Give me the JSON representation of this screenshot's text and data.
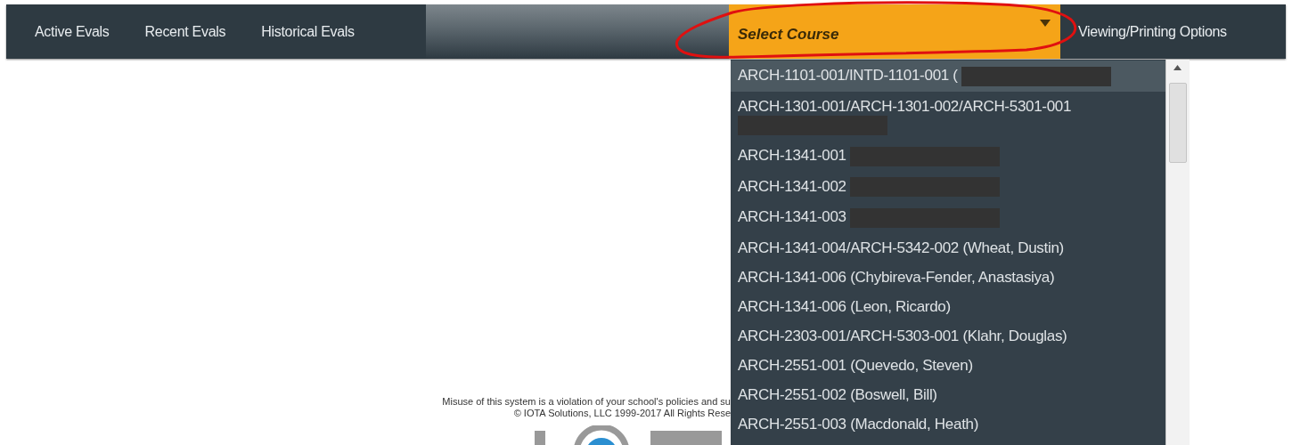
{
  "nav_tabs": [
    {
      "label": "Active Evals"
    },
    {
      "label": "Recent Evals"
    },
    {
      "label": "Historical Evals"
    }
  ],
  "course_select": {
    "placeholder": "Select Course",
    "expanded": true
  },
  "options_link": {
    "label": "Viewing/Printing Options"
  },
  "annotation_circle": true,
  "course_options": [
    {
      "label": "ARCH-1101-001/INTD-1101-001 (",
      "redacted": true,
      "selected": true
    },
    {
      "label": "ARCH-1301-001/ARCH-1301-002/ARCH-5301-001",
      "redacted": true,
      "selected": false
    },
    {
      "label": "ARCH-1341-001",
      "redacted": true,
      "selected": false
    },
    {
      "label": "ARCH-1341-002",
      "redacted": true,
      "selected": false
    },
    {
      "label": "ARCH-1341-003",
      "redacted": true,
      "selected": false
    },
    {
      "label": "ARCH-1341-004/ARCH-5342-002 (Wheat, Dustin)",
      "redacted": false,
      "selected": false
    },
    {
      "label": "ARCH-1341-006 (Chybireva-Fender, Anastasiya)",
      "redacted": false,
      "selected": false
    },
    {
      "label": "ARCH-1341-006 (Leon, Ricardo)",
      "redacted": false,
      "selected": false
    },
    {
      "label": "ARCH-2303-001/ARCH-5303-001 (Klahr, Douglas)",
      "redacted": false,
      "selected": false
    },
    {
      "label": "ARCH-2551-001 (Quevedo, Steven)",
      "redacted": false,
      "selected": false
    },
    {
      "label": "ARCH-2551-002 (Boswell, Bill)",
      "redacted": false,
      "selected": false
    },
    {
      "label": "ARCH-2551-003 (Macdonald, Heath)",
      "redacted": false,
      "selected": false
    }
  ],
  "footer": [
    "Misuse of this system is a violation of your school's policies and su",
    "© IOTA Solutions, LLC 1999-2017 All Rights Rese"
  ]
}
